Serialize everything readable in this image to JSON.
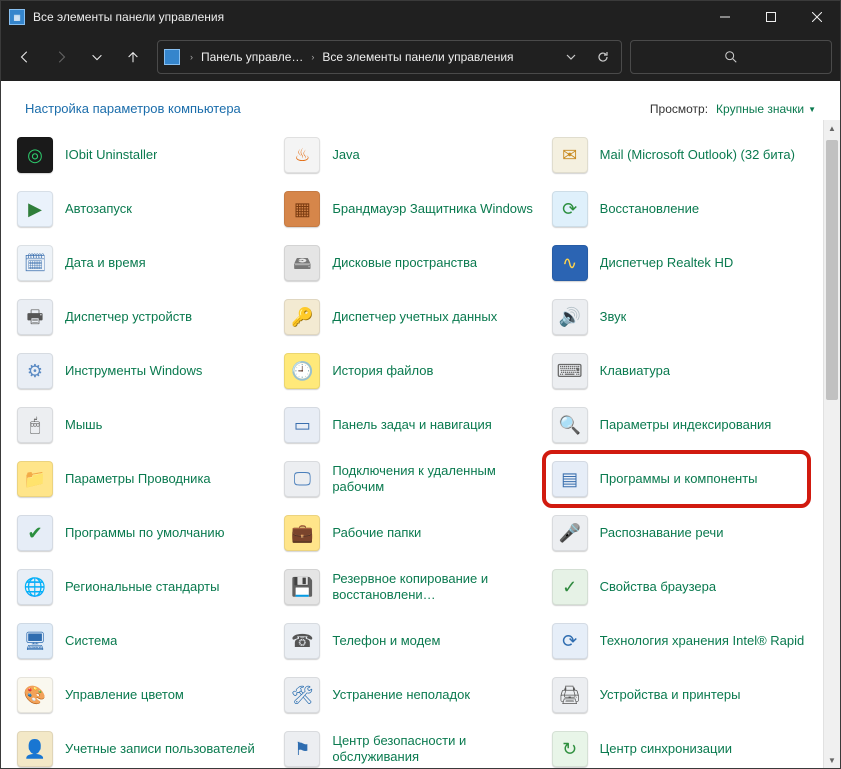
{
  "window": {
    "title": "Все элементы панели управления"
  },
  "breadcrumb": {
    "seg1": "Панель управле…",
    "seg2": "Все элементы панели управления"
  },
  "header": {
    "title": "Настройка параметров компьютера",
    "view_label": "Просмотр:",
    "view_value": "Крупные значки"
  },
  "items": [
    {
      "label": "IObit Uninstaller",
      "icon": "iobit"
    },
    {
      "label": "Java",
      "icon": "java"
    },
    {
      "label": "Mail (Microsoft Outlook) (32 бита)",
      "icon": "mail"
    },
    {
      "label": "Автозапуск",
      "icon": "autorun"
    },
    {
      "label": "Брандмауэр Защитника Windows",
      "icon": "firewall"
    },
    {
      "label": "Восстановление",
      "icon": "restore"
    },
    {
      "label": "Дата и время",
      "icon": "date"
    },
    {
      "label": "Дисковые пространства",
      "icon": "disk"
    },
    {
      "label": "Диспетчер Realtek HD",
      "icon": "realtek"
    },
    {
      "label": "Диспетчер устройств",
      "icon": "devmgr"
    },
    {
      "label": "Диспетчер учетных данных",
      "icon": "cred"
    },
    {
      "label": "Звук",
      "icon": "sound"
    },
    {
      "label": "Инструменты Windows",
      "icon": "tools"
    },
    {
      "label": "История файлов",
      "icon": "history"
    },
    {
      "label": "Клавиатура",
      "icon": "kbd"
    },
    {
      "label": "Мышь",
      "icon": "mouse"
    },
    {
      "label": "Панель задач и навигация",
      "icon": "taskbar"
    },
    {
      "label": "Параметры индексирования",
      "icon": "index"
    },
    {
      "label": "Параметры Проводника",
      "icon": "explorer"
    },
    {
      "label": "Подключения к удаленным рабочим",
      "icon": "rdp"
    },
    {
      "label": "Программы и компоненты",
      "icon": "progs",
      "hl": true
    },
    {
      "label": "Программы по умолчанию",
      "icon": "default"
    },
    {
      "label": "Рабочие папки",
      "icon": "workfld"
    },
    {
      "label": "Распознавание речи",
      "icon": "speech"
    },
    {
      "label": "Региональные стандарты",
      "icon": "region"
    },
    {
      "label": "Резервное копирование и восстановлени…",
      "icon": "backup"
    },
    {
      "label": "Свойства браузера",
      "icon": "browser"
    },
    {
      "label": "Система",
      "icon": "system"
    },
    {
      "label": "Телефон и модем",
      "icon": "phone"
    },
    {
      "label": "Технология хранения Intel® Rapid",
      "icon": "rapid"
    },
    {
      "label": "Управление цветом",
      "icon": "color"
    },
    {
      "label": "Устранение неполадок",
      "icon": "trouble"
    },
    {
      "label": "Устройства и принтеры",
      "icon": "devices"
    },
    {
      "label": "Учетные записи пользователей",
      "icon": "users"
    },
    {
      "label": "Центр безопасности и обслуживания",
      "icon": "security"
    },
    {
      "label": "Центр синхронизации",
      "icon": "sync"
    }
  ]
}
